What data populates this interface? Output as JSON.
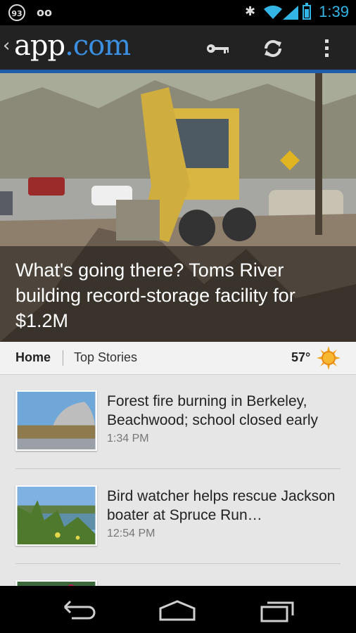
{
  "status_bar": {
    "notification_count": "93",
    "voicemail_icon": "voicemail-icon",
    "time": "1:39"
  },
  "app_bar": {
    "logo_text_main": "app",
    "logo_text_dot": ".com",
    "icons": [
      "key-icon",
      "refresh-icon",
      "overflow-menu-icon"
    ]
  },
  "hero": {
    "headline": "What's going there? Toms River building record-storage facility for $1.2M"
  },
  "tabs": {
    "home": "Home",
    "top_stories": "Top Stories",
    "temperature": "57°",
    "weather_icon": "sun-icon"
  },
  "stories": [
    {
      "title": "Forest fire burning in Berkeley, Beachwood; school closed early",
      "time": "1:34 PM"
    },
    {
      "title": "Bird watcher helps rescue Jackson boater at Spruce Run…",
      "time": "12:54 PM"
    }
  ],
  "colors": {
    "accent": "#33b5e5",
    "brand_blue": "#1f5da8",
    "app_bar_bg": "#222222"
  }
}
